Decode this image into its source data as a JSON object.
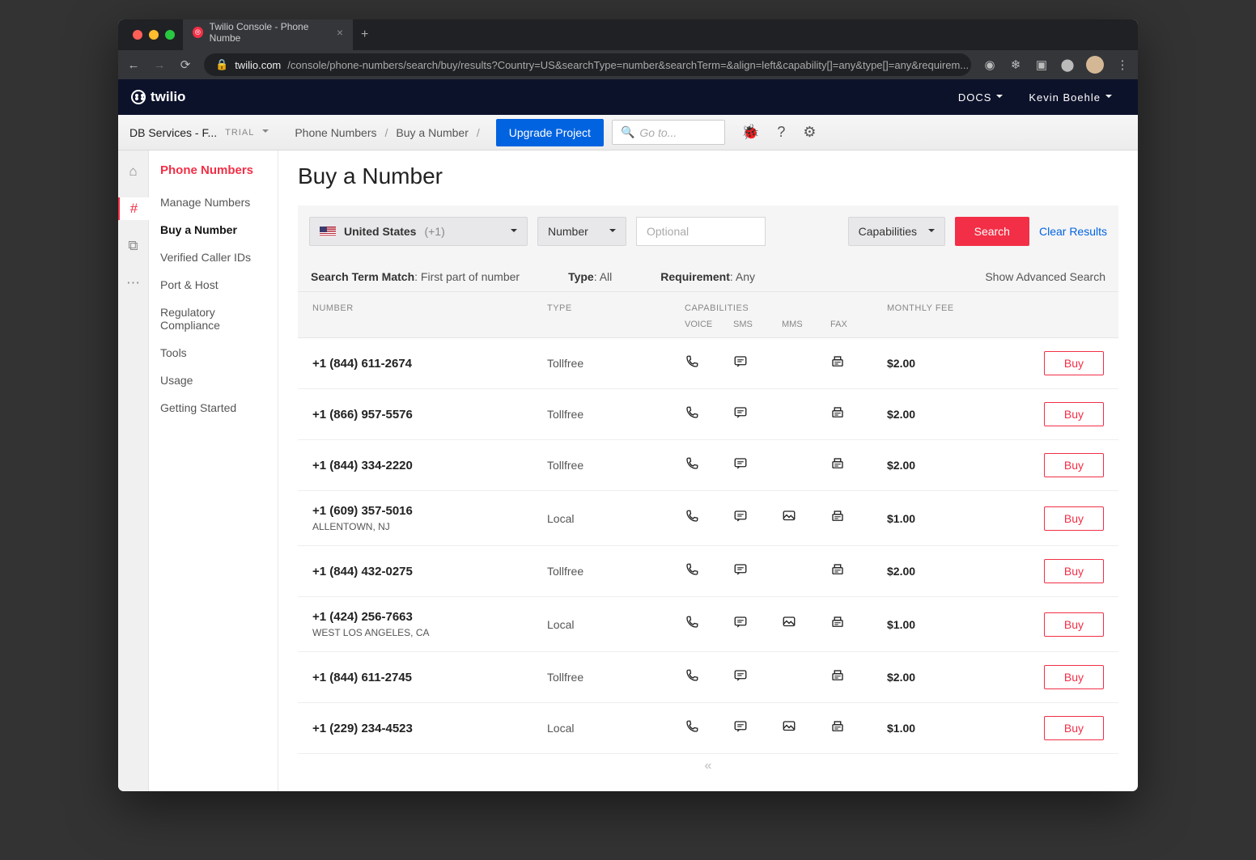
{
  "browser": {
    "tab_title": "Twilio Console - Phone Numbe",
    "url_host": "twilio.com",
    "url_path": "/console/phone-numbers/search/buy/results?Country=US&searchType=number&searchTerm=&align=left&capability[]=any&type[]=any&requirem..."
  },
  "header": {
    "brand": "twilio",
    "docs_label": "DOCS",
    "user_name": "Kevin Boehle"
  },
  "subheader": {
    "project": "DB Services - F...",
    "trial": "TRIAL",
    "crumb1": "Phone Numbers",
    "crumb2": "Buy a Number",
    "upgrade": "Upgrade Project",
    "search_placeholder": "Go to..."
  },
  "sidebar": {
    "title": "Phone Numbers",
    "items": [
      "Manage Numbers",
      "Buy a Number",
      "Verified Caller IDs",
      "Port & Host",
      "Regulatory Compliance",
      "Tools",
      "Usage",
      "Getting Started"
    ]
  },
  "page": {
    "title": "Buy a Number",
    "country": "United States",
    "country_code": "(+1)",
    "match_select": "Number",
    "input_placeholder": "Optional",
    "capabilities_label": "Capabilities",
    "search_btn": "Search",
    "clear": "Clear Results",
    "meta_match_label": "Search Term Match",
    "meta_match_val": ": First part of number",
    "meta_type_label": "Type",
    "meta_type_val": ": All",
    "meta_req_label": "Requirement",
    "meta_req_val": ": Any",
    "adv": "Show Advanced Search",
    "col_number": "Number",
    "col_type": "Type",
    "col_caps": "Capabilities",
    "col_fee": "Monthly Fee",
    "sub_voice": "Voice",
    "sub_sms": "SMS",
    "sub_mms": "MMS",
    "sub_fax": "Fax",
    "buy_label": "Buy"
  },
  "rows": [
    {
      "number": "+1 (844) 611-2674",
      "location": "",
      "type": "Tollfree",
      "voice": true,
      "sms": true,
      "mms": false,
      "fax": true,
      "fee": "$2.00"
    },
    {
      "number": "+1 (866) 957-5576",
      "location": "",
      "type": "Tollfree",
      "voice": true,
      "sms": true,
      "mms": false,
      "fax": true,
      "fee": "$2.00"
    },
    {
      "number": "+1 (844) 334-2220",
      "location": "",
      "type": "Tollfree",
      "voice": true,
      "sms": true,
      "mms": false,
      "fax": true,
      "fee": "$2.00"
    },
    {
      "number": "+1 (609) 357-5016",
      "location": "ALLENTOWN, NJ",
      "type": "Local",
      "voice": true,
      "sms": true,
      "mms": true,
      "fax": true,
      "fee": "$1.00"
    },
    {
      "number": "+1 (844) 432-0275",
      "location": "",
      "type": "Tollfree",
      "voice": true,
      "sms": true,
      "mms": false,
      "fax": true,
      "fee": "$2.00"
    },
    {
      "number": "+1 (424) 256-7663",
      "location": "WEST LOS ANGELES, CA",
      "type": "Local",
      "voice": true,
      "sms": true,
      "mms": true,
      "fax": true,
      "fee": "$1.00"
    },
    {
      "number": "+1 (844) 611-2745",
      "location": "",
      "type": "Tollfree",
      "voice": true,
      "sms": true,
      "mms": false,
      "fax": true,
      "fee": "$2.00"
    },
    {
      "number": "+1 (229) 234-4523",
      "location": "",
      "type": "Local",
      "voice": true,
      "sms": true,
      "mms": true,
      "fax": true,
      "fee": "$1.00"
    }
  ]
}
